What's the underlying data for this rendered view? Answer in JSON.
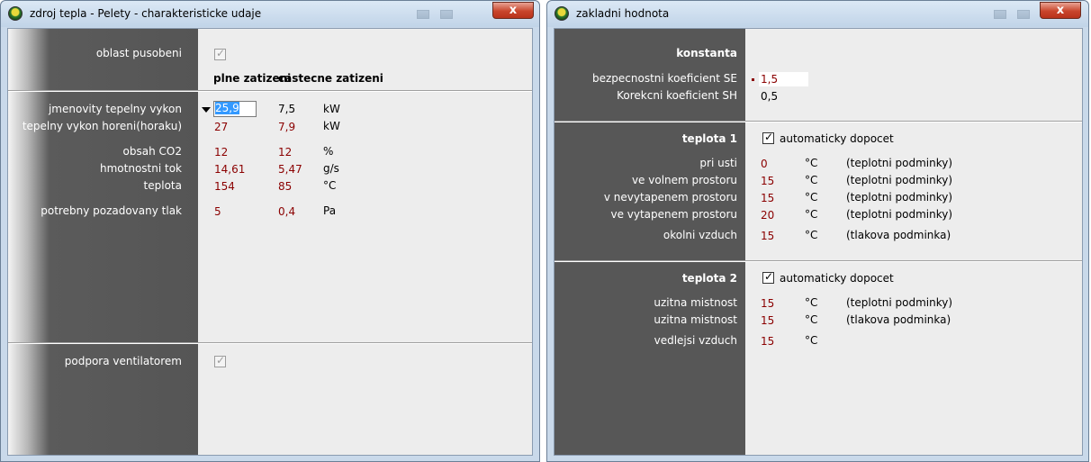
{
  "win1": {
    "title": "zdroj tepla - Pelety - charakteristicke udaje",
    "close_label": "x",
    "oblast_label": "oblast pusobeni",
    "col_headers": [
      "plne zatizeni",
      "castecne zatizeni"
    ],
    "rows": [
      {
        "label": "jmenovity tepelny vykon",
        "full": "25,9",
        "partial": "7,5",
        "unit": "kW"
      },
      {
        "label": "tepelny vykon horeni(horaku)",
        "full": "27",
        "partial": "7,9",
        "unit": "kW"
      },
      {
        "label": "obsah CO2",
        "full": "12",
        "partial": "12",
        "unit": "%"
      },
      {
        "label": "hmotnostni tok",
        "full": "14,61",
        "partial": "5,47",
        "unit": "g/s"
      },
      {
        "label": "teplota",
        "full": "154",
        "partial": "85",
        "unit": "°C"
      },
      {
        "label": "potrebny pozadovany tlak",
        "full": "5",
        "partial": "0,4",
        "unit": "Pa"
      }
    ],
    "podpora_label": "podpora ventilatorem"
  },
  "win2": {
    "title": "zakladni hodnota",
    "close_label": "x",
    "konstanta_label": "konstanta",
    "se_label": "bezpecnostni koeficient SE",
    "se_value": "1,5",
    "sh_label": "Korekcni koeficient SH",
    "sh_value": "0,5",
    "teplota1_label": "teplota 1",
    "auto_label": "automaticky dopocet",
    "t1_rows": [
      {
        "label": "pri usti",
        "value": "0",
        "unit": "°C",
        "note": "(teplotni podminky)"
      },
      {
        "label": "ve volnem prostoru",
        "value": "15",
        "unit": "°C",
        "note": "(teplotni podminky)"
      },
      {
        "label": "v nevytapenem prostoru",
        "value": "15",
        "unit": "°C",
        "note": "(teplotni podminky)"
      },
      {
        "label": "ve vytapenem prostoru",
        "value": "20",
        "unit": "°C",
        "note": "(teplotni podminky)"
      },
      {
        "label": "okolni vzduch",
        "value": "15",
        "unit": "°C",
        "note": "(tlakova podminka)"
      }
    ],
    "teplota2_label": "teplota 2",
    "t2_rows": [
      {
        "label": "uzitna mistnost",
        "value": "15",
        "unit": "°C",
        "note": "(teplotni podminky)"
      },
      {
        "label": "uzitna mistnost",
        "value": "15",
        "unit": "°C",
        "note": "(tlakova podminka)"
      },
      {
        "label": "vedlejsi vzduch",
        "value": "15",
        "unit": "°C",
        "note": ""
      }
    ]
  }
}
